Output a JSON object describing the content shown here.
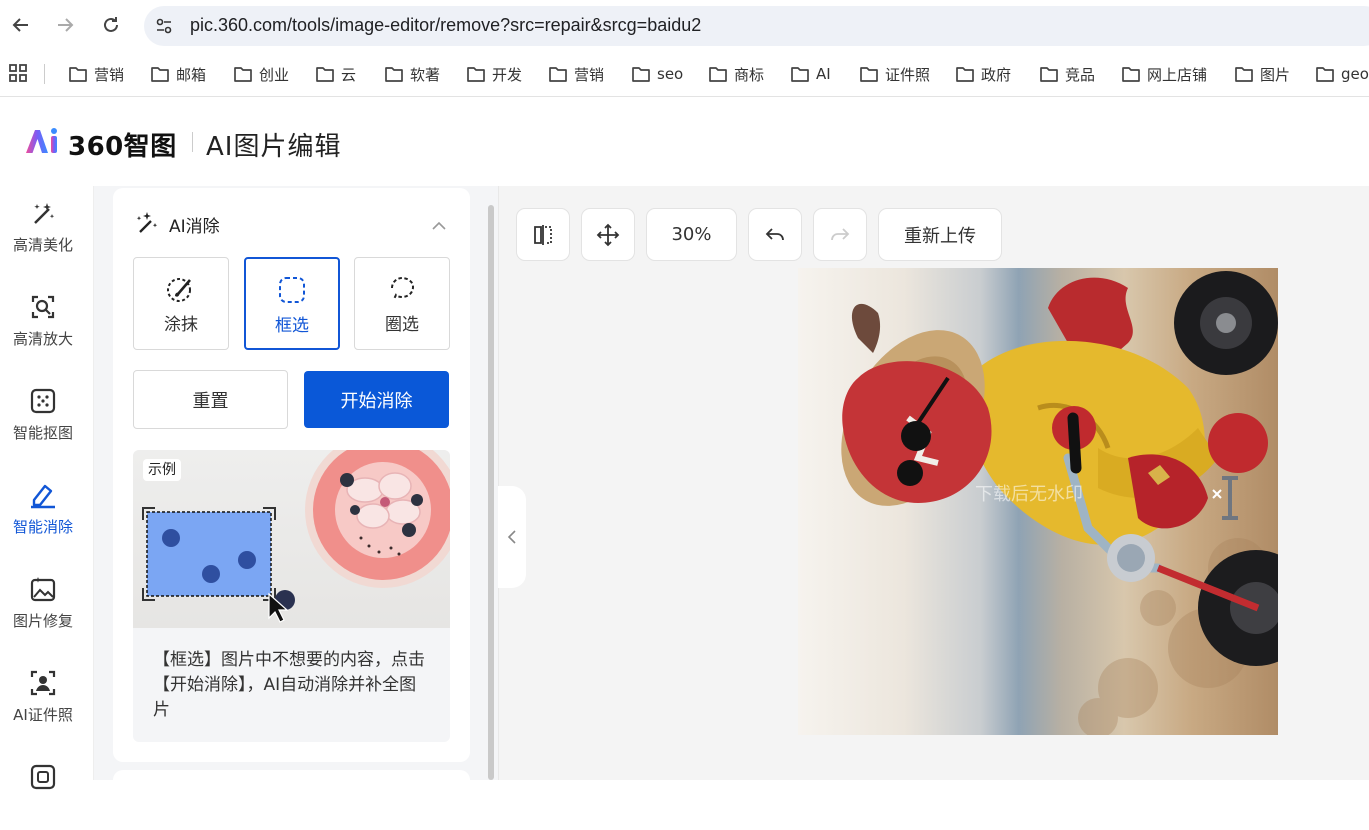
{
  "browser": {
    "url": "pic.360.com/tools/image-editor/remove?src=repair&srcg=baidu2"
  },
  "bookmarks": [
    "营销",
    "邮箱",
    "创业",
    "云",
    "软著",
    "开发",
    "营销",
    "seo",
    "商标",
    "AI",
    "证件照",
    "政府",
    "竞品",
    "网上店铺",
    "图片",
    "geo"
  ],
  "header": {
    "logo_text": "360智图",
    "app_title": "AI图片编辑"
  },
  "rail": {
    "items": [
      {
        "label": "高清美化",
        "icon": "magic-wand-icon"
      },
      {
        "label": "高清放大",
        "icon": "upscale-icon"
      },
      {
        "label": "智能抠图",
        "icon": "cutout-icon"
      },
      {
        "label": "智能消除",
        "icon": "eraser-icon",
        "active": true
      },
      {
        "label": "图片修复",
        "icon": "image-repair-icon"
      },
      {
        "label": "AI证件照",
        "icon": "id-photo-icon"
      }
    ]
  },
  "panel": {
    "title": "AI消除",
    "modes": [
      {
        "label": "涂抹",
        "icon": "brush-icon"
      },
      {
        "label": "框选",
        "icon": "box-select-icon",
        "active": true
      },
      {
        "label": "圈选",
        "icon": "lasso-icon"
      }
    ],
    "reset_label": "重置",
    "start_label": "开始消除",
    "example_tag": "示例",
    "example_desc": "【框选】图片中不想要的内容，点击【开始消除】，AI自动消除并补全图片"
  },
  "toolbar": {
    "zoom": "30%",
    "reupload": "重新上传"
  },
  "canvas": {
    "watermark": "下载后无水印"
  },
  "colors": {
    "accent": "#0a58d8",
    "active_text": "#1156d6"
  }
}
